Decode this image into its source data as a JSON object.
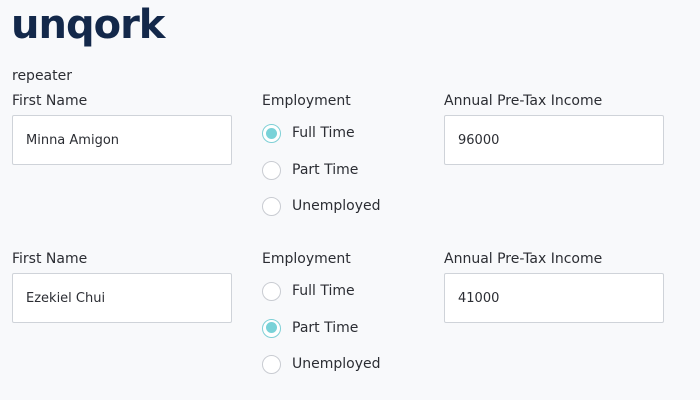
{
  "brand": {
    "logo_text": "unqork"
  },
  "section": {
    "label": "repeater"
  },
  "rows": [
    {
      "first_name_label": "First Name",
      "first_name_value": "Minna Amigon",
      "employment_label": "Employment",
      "employment_options": [
        {
          "label": "Full Time",
          "checked": true
        },
        {
          "label": "Part Time",
          "checked": false
        },
        {
          "label": "Unemployed",
          "checked": false
        }
      ],
      "income_label": "Annual Pre-Tax Income",
      "income_value": "96000"
    },
    {
      "first_name_label": "First Name",
      "first_name_value": "Ezekiel Chui",
      "employment_label": "Employment",
      "employment_options": [
        {
          "label": "Full Time",
          "checked": false
        },
        {
          "label": "Part Time",
          "checked": true
        },
        {
          "label": "Unemployed",
          "checked": false
        }
      ],
      "income_label": "Annual Pre-Tax Income",
      "income_value": "41000"
    }
  ],
  "colors": {
    "logo": "#13284a",
    "radio_checked": "#79d2d8",
    "input_border": "#cfd3d9",
    "background": "#f8f9fb"
  }
}
